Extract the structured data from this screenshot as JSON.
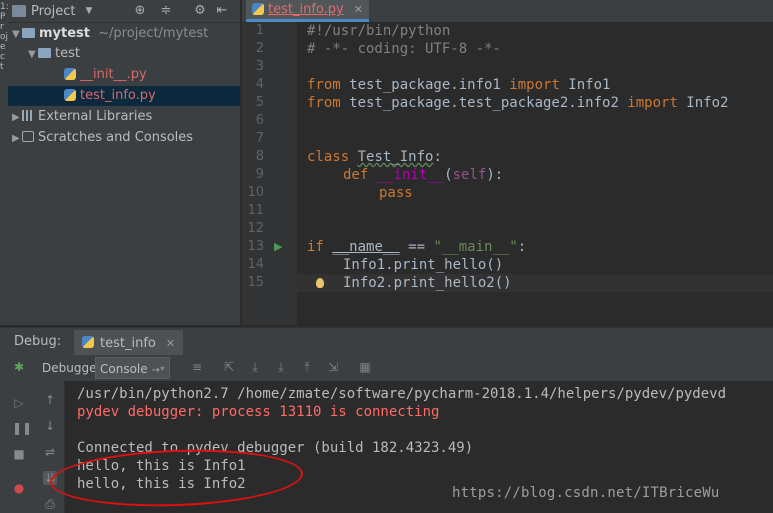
{
  "left_strip": {
    "label": "1:Project"
  },
  "project_panel": {
    "title": "Project",
    "tree": [
      {
        "label": "mytest",
        "suffix": "~/project/mytest"
      },
      {
        "label": "test"
      },
      {
        "label": "__init__.py"
      },
      {
        "label": "test_info.py"
      },
      {
        "label": "External Libraries"
      },
      {
        "label": "Scratches and Consoles"
      }
    ]
  },
  "editor": {
    "tab_label": "test_info.py",
    "line_numbers": [
      "1",
      "2",
      "3",
      "4",
      "5",
      "6",
      "7",
      "8",
      "9",
      "10",
      "11",
      "12",
      "13",
      "14",
      "15"
    ],
    "code": {
      "l1": "#!/usr/bin/python",
      "l2": "# -*- coding: UTF-8 -*-",
      "l4_kw1": "from",
      "l4_mid": " test_package.info1 ",
      "l4_kw2": "import",
      "l4_end": " Info1",
      "l5_kw1": "from",
      "l5_mid": " test_package.test_package2.info2 ",
      "l5_kw2": "import",
      "l5_end": " Info2",
      "l8_kw": "class",
      "l8_name": "Test_Info",
      "l8_end": ":",
      "l9_kw": "def",
      "l9_name": "__init__",
      "l9_open": "(",
      "l9_self": "self",
      "l9_close": "):",
      "l10": "pass",
      "l13_kw": "if",
      "l13_name": "__name__",
      "l13_op": " == ",
      "l13_str": "\"__main__\"",
      "l13_end": ":",
      "l14": "Info1.print_hello()",
      "l15": "Info2.print_hello2()"
    }
  },
  "debug": {
    "label": "Debug:",
    "tab_label": "test_info",
    "toolbar": {
      "debugger": "Debugger",
      "console": "Console"
    },
    "console_lines": [
      "/usr/bin/python2.7 /home/zmate/software/pycharm-2018.1.4/helpers/pydev/pydevd",
      "pydev debugger: process 13110 is connecting",
      "",
      "Connected to pydev debugger (build 182.4323.49)",
      "hello, this is Info1",
      "hello, this is Info2"
    ]
  },
  "watermark": "https://blog.csdn.net/ITBriceWu",
  "colors": {
    "keyword": "#cc7832",
    "comment": "#808080",
    "string": "#6a8759",
    "error": "#ff6b68",
    "selection": "#0d293e",
    "annotation": "#e01010"
  }
}
